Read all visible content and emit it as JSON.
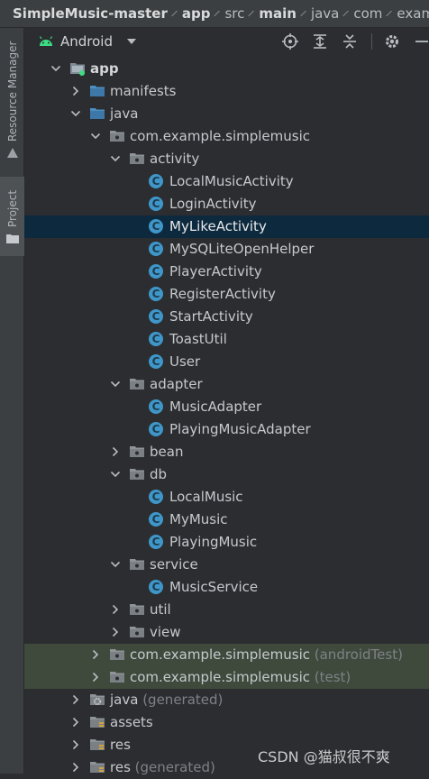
{
  "breadcrumb": [
    {
      "label": "SimpleMusic-master",
      "bold": true
    },
    {
      "label": "app",
      "bold": true
    },
    {
      "label": "src",
      "bold": false
    },
    {
      "label": "main",
      "bold": true
    },
    {
      "label": "java",
      "bold": false
    },
    {
      "label": "com",
      "bold": false
    },
    {
      "label": "exam",
      "bold": false
    }
  ],
  "side_tabs": {
    "resource_manager": "Resource Manager",
    "project": "Project"
  },
  "toolbar": {
    "view_mode": "Android",
    "icons": [
      "locate-icon",
      "expand-all-icon",
      "collapse-all-icon",
      "settings-gear-icon",
      "hide-panel-icon"
    ]
  },
  "tree": [
    {
      "label": "app",
      "depth": 0,
      "expanded": true,
      "icon": "module",
      "bold": true
    },
    {
      "label": "manifests",
      "depth": 1,
      "expanded": false,
      "icon": "folder-blue"
    },
    {
      "label": "java",
      "depth": 1,
      "expanded": true,
      "icon": "folder-blue"
    },
    {
      "label": "com.example.simplemusic",
      "depth": 2,
      "expanded": true,
      "icon": "package"
    },
    {
      "label": "activity",
      "depth": 3,
      "expanded": true,
      "icon": "package"
    },
    {
      "label": "LocalMusicActivity",
      "depth": 4,
      "icon": "class"
    },
    {
      "label": "LoginActivity",
      "depth": 4,
      "icon": "class"
    },
    {
      "label": "MyLikeActivity",
      "depth": 4,
      "icon": "class",
      "selected": true
    },
    {
      "label": "MySQLiteOpenHelper",
      "depth": 4,
      "icon": "class"
    },
    {
      "label": "PlayerActivity",
      "depth": 4,
      "icon": "class"
    },
    {
      "label": "RegisterActivity",
      "depth": 4,
      "icon": "class"
    },
    {
      "label": "StartActivity",
      "depth": 4,
      "icon": "class"
    },
    {
      "label": "ToastUtil",
      "depth": 4,
      "icon": "class"
    },
    {
      "label": "User",
      "depth": 4,
      "icon": "class"
    },
    {
      "label": "adapter",
      "depth": 3,
      "expanded": true,
      "icon": "package"
    },
    {
      "label": "MusicAdapter",
      "depth": 4,
      "icon": "class"
    },
    {
      "label": "PlayingMusicAdapter",
      "depth": 4,
      "icon": "class"
    },
    {
      "label": "bean",
      "depth": 3,
      "expanded": false,
      "icon": "package"
    },
    {
      "label": "db",
      "depth": 3,
      "expanded": true,
      "icon": "package"
    },
    {
      "label": "LocalMusic",
      "depth": 4,
      "icon": "class"
    },
    {
      "label": "MyMusic",
      "depth": 4,
      "icon": "class"
    },
    {
      "label": "PlayingMusic",
      "depth": 4,
      "icon": "class"
    },
    {
      "label": "service",
      "depth": 3,
      "expanded": true,
      "icon": "package"
    },
    {
      "label": "MusicService",
      "depth": 4,
      "icon": "class"
    },
    {
      "label": "util",
      "depth": 3,
      "expanded": false,
      "icon": "package"
    },
    {
      "label": "view",
      "depth": 3,
      "expanded": false,
      "icon": "package"
    },
    {
      "label": "com.example.simplemusic",
      "suffix": "(androidTest)",
      "depth": 2,
      "expanded": false,
      "icon": "package",
      "tinted": true
    },
    {
      "label": "com.example.simplemusic",
      "suffix": "(test)",
      "depth": 2,
      "expanded": false,
      "icon": "package",
      "tinted": true
    },
    {
      "label": "java",
      "suffix": "(generated)",
      "depth": 1,
      "expanded": false,
      "icon": "folder-generated"
    },
    {
      "label": "assets",
      "depth": 1,
      "expanded": false,
      "icon": "folder-resources"
    },
    {
      "label": "res",
      "depth": 1,
      "expanded": false,
      "icon": "folder-resources"
    },
    {
      "label": "res",
      "suffix": "(generated)",
      "depth": 1,
      "expanded": false,
      "icon": "folder-resources"
    }
  ],
  "class_icon_letter": "C",
  "watermark": "CSDN @猫叔很不爽",
  "colors": {
    "background": "#2b2d30",
    "selection": "#0d293e",
    "test_tint": "#3f4a3d",
    "class_icon": "#3f97c9",
    "android_green": "#3ddc84"
  }
}
